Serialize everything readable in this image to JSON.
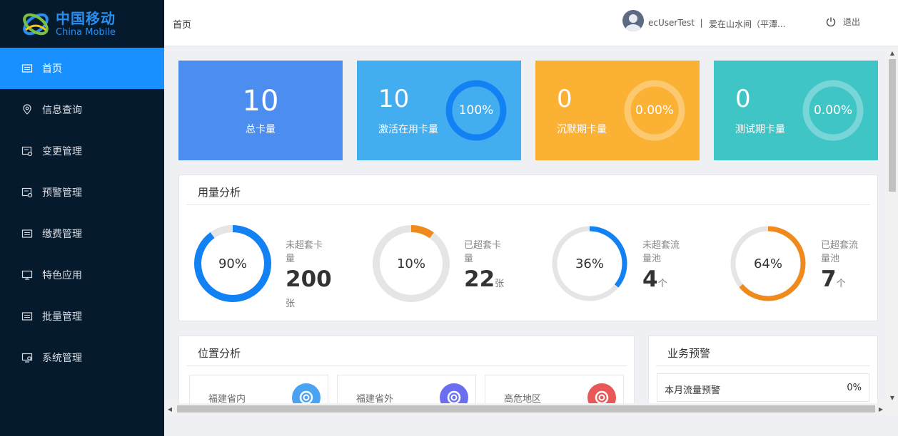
{
  "brand": {
    "name_cn": "中国移动",
    "name_en": "China Mobile",
    "color": "#2a8ef0"
  },
  "sidebar": {
    "items": [
      {
        "label": "首页",
        "icon": "home-icon",
        "active": true
      },
      {
        "label": "信息查询",
        "icon": "location-pin-icon"
      },
      {
        "label": "变更管理",
        "icon": "change-icon"
      },
      {
        "label": "预警管理",
        "icon": "alert-icon"
      },
      {
        "label": "缴费管理",
        "icon": "payment-icon"
      },
      {
        "label": "特色应用",
        "icon": "monitor-icon"
      },
      {
        "label": "批量管理",
        "icon": "batch-icon"
      },
      {
        "label": "系统管理",
        "icon": "settings-icon"
      }
    ]
  },
  "header": {
    "breadcrumb": "首页",
    "username": "ecUserTest",
    "separator": "|",
    "company": "爱在山水间（平潭...",
    "logout": "退出"
  },
  "stats": [
    {
      "value": "10",
      "label": "总卡量",
      "color": "#4b8ef0"
    },
    {
      "value": "10",
      "label": "激活在用卡量",
      "percent": "100%",
      "fraction": 1.0,
      "color": "#42aef0",
      "ring_color": "#1281f3"
    },
    {
      "value": "0",
      "label": "沉默期卡量",
      "percent": "0.00%",
      "fraction": 0,
      "color": "#fbb133"
    },
    {
      "value": "0",
      "label": "测试期卡量",
      "percent": "0.00%",
      "fraction": 0,
      "color": "#40c5c7"
    }
  ],
  "usage_panel": {
    "title": "用量分析",
    "items": [
      {
        "percent": "90%",
        "fraction": 0.9,
        "label": "未超套卡量",
        "value": "200",
        "unit": "张",
        "color": "#1281f3"
      },
      {
        "percent": "10%",
        "fraction": 0.1,
        "label": "已超套卡量",
        "value": "22",
        "unit": "张",
        "color": "#f08a1c"
      },
      {
        "percent": "36%",
        "fraction": 0.36,
        "label": "未超套流量池",
        "value": "4",
        "unit": "个",
        "color": "#1281f3"
      },
      {
        "percent": "64%",
        "fraction": 0.64,
        "label": "已超套流量池",
        "value": "7",
        "unit": "个",
        "color": "#f08a1c"
      }
    ]
  },
  "location_panel": {
    "title": "位置分析",
    "items": [
      {
        "label": "福建省内",
        "icon": "lifebuoy-icon",
        "color": "#4aa3f2"
      },
      {
        "label": "福建省外",
        "icon": "lifebuoy-icon",
        "color": "#6b6ef0"
      },
      {
        "label": "高危地区",
        "icon": "lifebuoy-icon",
        "color": "#e85858"
      }
    ]
  },
  "warning_panel": {
    "title": "业务预警",
    "rows": [
      {
        "label": "本月流量预警",
        "value": "0%"
      }
    ]
  }
}
